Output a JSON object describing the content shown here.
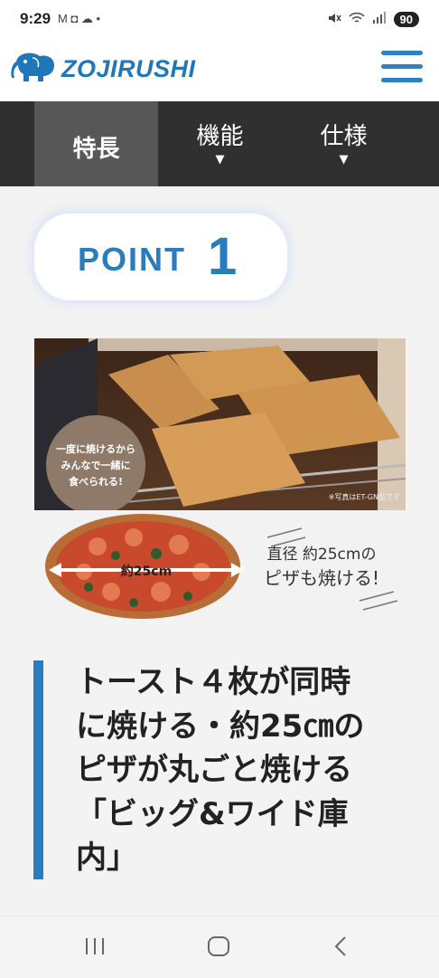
{
  "status_bar": {
    "time": "9:29",
    "notification_icons": "M ◘ ☁ •",
    "battery": "90"
  },
  "header": {
    "brand": "ZOJIRUSHI"
  },
  "nav": {
    "tabs": [
      {
        "label": "特長",
        "has_dropdown": false,
        "active": true
      },
      {
        "label": "機能",
        "arrow": "▼"
      },
      {
        "label": "仕様",
        "arrow": "▼"
      }
    ]
  },
  "point": {
    "label": "POINT",
    "number": "1"
  },
  "product_image": {
    "toast_bubble": [
      "一度に焼けるから",
      "みんなで一緒に",
      "食べられる!"
    ],
    "toast_note": "※写真はET-GN型です",
    "pizza_label": "約25cm",
    "pizza_caption_line1": "直径 約25cmの",
    "pizza_caption_line2": "ピザも焼ける!"
  },
  "headline": {
    "lines": [
      "トースト４枚が同時",
      "に焼ける・約25㎝の",
      "ピザが丸ごと焼ける",
      "「ビッグ&ワイド庫",
      "内」"
    ]
  },
  "colors": {
    "brand_blue": "#2a7dbd",
    "nav_bg": "#303030",
    "nav_active": "#575757"
  }
}
